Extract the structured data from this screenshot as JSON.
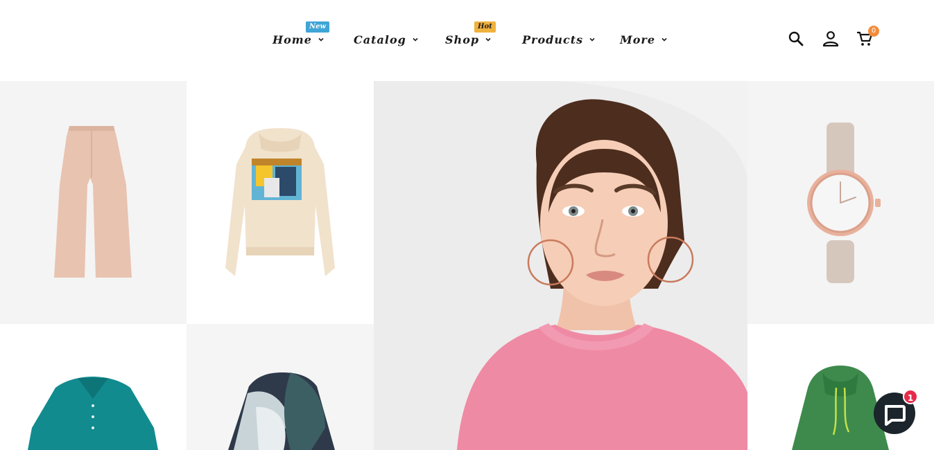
{
  "nav": {
    "items": [
      {
        "label": "Home",
        "badge": "New"
      },
      {
        "label": "Catalog",
        "badge": ""
      },
      {
        "label": "Shop",
        "badge": "Hot"
      },
      {
        "label": "Products",
        "badge": ""
      },
      {
        "label": "More",
        "badge": ""
      }
    ]
  },
  "icons": {
    "search": "search-icon",
    "account": "user-icon",
    "cart": "cart-icon",
    "chat": "chat-icon"
  },
  "cart": {
    "count": "0"
  },
  "chat": {
    "unread": "1"
  },
  "colors": {
    "badge_new": "#3fa5d6",
    "badge_hot": "#f0b23e",
    "cart_badge": "#f28c3b",
    "chat_badge": "#e62a4b",
    "text": "#1b1b1b"
  }
}
